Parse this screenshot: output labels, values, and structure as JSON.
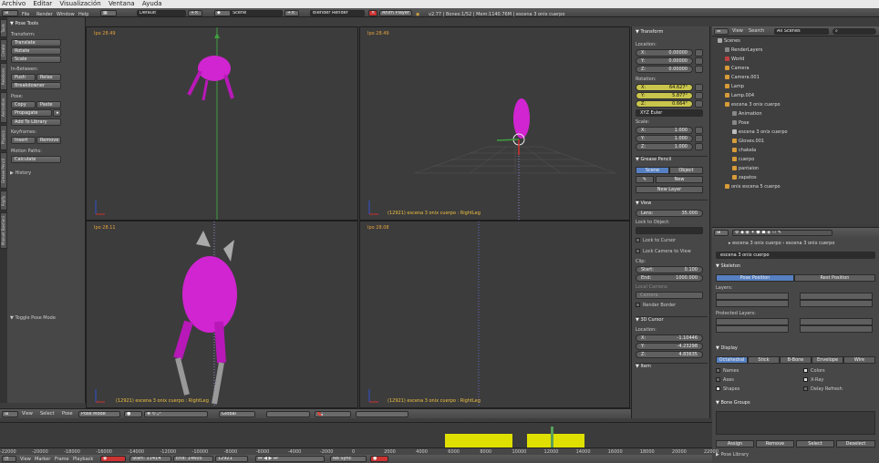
{
  "os_menu": [
    "Archivo",
    "Editar",
    "Visualización",
    "Ventana",
    "Ayuda"
  ],
  "info_header": {
    "menus": [
      "File",
      "Render",
      "Window",
      "Help"
    ],
    "screen_layout": "Default",
    "scene": "Scene",
    "render_engine": "Blender Render",
    "anim_player": "Anim Player",
    "stats": "v2.77 | Bones:1/52 | Mem:1140.76M | escena 3 onix cuerpo"
  },
  "left_tabs": [
    "Tools",
    "Create",
    "Relations",
    "Animation",
    "Physics",
    "Grease Pencil",
    "Rigify",
    "Manuel Bastioni"
  ],
  "tool_shelf": {
    "title": "Pose Tools",
    "transform_label": "Transform:",
    "transform_buttons": [
      "Translate",
      "Rotate",
      "Scale"
    ],
    "in_between_label": "In-Between:",
    "push": "Push",
    "relax": "Relax",
    "breakdowner": "Breakdowner",
    "pose_label": "Pose:",
    "copy": "Copy",
    "paste": "Paste",
    "propagate": "Propagate",
    "add_to_library": "Add To Library",
    "keyframes_label": "Keyframes:",
    "insert": "Insert",
    "remove": "Remove",
    "motion_paths_label": "Motion Paths:",
    "calculate": "Calculate",
    "history": "History",
    "toggle_pose_mode": "Toggle Pose Mode"
  },
  "viewports": [
    {
      "label": "Ipo 28.49",
      "status": ""
    },
    {
      "label": "Ipo 28.49",
      "status": "(12921) escena 3 onix cuerpo : RightLeg"
    },
    {
      "label": "Ipo 28.11",
      "status": "(12921) escena 3 onix cuerpo : RightLeg"
    },
    {
      "label": "Ipo 28.08",
      "status": "(12921) escena 3 onix cuerpo : RightLeg"
    }
  ],
  "viewport_statuses": [
    "(12921) escena 3 onix cuerpo : RightLeg",
    "(12921) escena 3 onix cuerpo : RightLeg"
  ],
  "viewport_header": {
    "view": "View",
    "select": "Select",
    "pose": "Pose",
    "mode": "Pose Mode",
    "orientation": "Global"
  },
  "transform_panel": {
    "title": "Transform",
    "location_label": "Location:",
    "location": [
      {
        "axis": "X:",
        "value": "0.00000"
      },
      {
        "axis": "Y:",
        "value": "0.00000"
      },
      {
        "axis": "Z:",
        "value": "0.00000"
      }
    ],
    "rotation_label": "Rotation:",
    "rotation": [
      {
        "axis": "X:",
        "value": "64.627°"
      },
      {
        "axis": "Y:",
        "value": "5.877°"
      },
      {
        "axis": "Z:",
        "value": "0.664°"
      }
    ],
    "rotation_mode": "XYZ Euler",
    "scale_label": "Scale:",
    "scale": [
      {
        "axis": "X:",
        "value": "1.000"
      },
      {
        "axis": "Y:",
        "value": "1.000"
      },
      {
        "axis": "Z:",
        "value": "1.000"
      }
    ]
  },
  "grease_pencil": {
    "title": "Grease Pencil",
    "scene": "Scene",
    "object": "Object",
    "new": "New",
    "new_layer": "New Layer"
  },
  "view_panel": {
    "title": "View",
    "lens_label": "Lens:",
    "lens": "35.000",
    "lock_to_object": "Lock to Object:",
    "lock_to_cursor": "Lock to Cursor",
    "lock_camera": "Lock Camera to View",
    "clip_label": "Clip:",
    "start_label": "Start:",
    "start": "0.100",
    "end_label": "End:",
    "end": "1000.000",
    "local_camera": "Local Camera:",
    "camera": "Camera",
    "render_border": "Render Border"
  },
  "cursor_panel": {
    "title": "3D Cursor",
    "location_label": "Location:",
    "location": [
      {
        "axis": "X:",
        "value": "-1.10446"
      },
      {
        "axis": "Y:",
        "value": "-4.23298"
      },
      {
        "axis": "Z:",
        "value": "4.83635"
      }
    ]
  },
  "item_label": "Item",
  "outliner": {
    "view": "View",
    "search": "Search",
    "filter": "All Scenes",
    "items": [
      {
        "label": "Scenes",
        "depth": 0,
        "color": "#aaaaaa"
      },
      {
        "label": "RenderLayers",
        "depth": 1,
        "color": "#888888"
      },
      {
        "label": "World",
        "depth": 1,
        "color": "#c04040"
      },
      {
        "label": "Camera",
        "depth": 1,
        "color": "#d79b38"
      },
      {
        "label": "Camera.001",
        "depth": 1,
        "color": "#d79b38"
      },
      {
        "label": "Lamp",
        "depth": 1,
        "color": "#d79b38"
      },
      {
        "label": "Lamp.004",
        "depth": 1,
        "color": "#d79b38"
      },
      {
        "label": "escena 3 onix cuerpo",
        "depth": 1,
        "color": "#d79b38"
      },
      {
        "label": "Animation",
        "depth": 2,
        "color": "#888888"
      },
      {
        "label": "Pose",
        "depth": 2,
        "color": "#888888"
      },
      {
        "label": "escena 3 onix cuerpo",
        "depth": 2,
        "color": "#bbbbbb"
      },
      {
        "label": "Gloves.001",
        "depth": 2,
        "color": "#d79b38"
      },
      {
        "label": "chakela",
        "depth": 2,
        "color": "#d79b38"
      },
      {
        "label": "cuerpo",
        "depth": 2,
        "color": "#d79b38"
      },
      {
        "label": "pantalon",
        "depth": 2,
        "color": "#d79b38"
      },
      {
        "label": "zapatos",
        "depth": 2,
        "color": "#d79b38"
      },
      {
        "label": "onix escena 5 cuerpo",
        "depth": 1,
        "color": "#d79b38"
      }
    ]
  },
  "bone_props": {
    "breadcrumb_1": "escena 3 onix cuerpo",
    "breadcrumb_2": "escena 3 onix cuerpo",
    "armature_name": "escena 3 onix cuerpo",
    "skeleton_title": "Skeleton",
    "pose_position": "Pose Position",
    "rest_position": "Rest Position",
    "layers_label": "Layers:",
    "protected_layers": "Protected Layers:",
    "display_title": "Display",
    "display_tabs": [
      "Octahedral",
      "Stick",
      "B-Bone",
      "Envelope",
      "Wire"
    ],
    "names": "Names",
    "axes": "Axes",
    "shapes": "Shapes",
    "colors": "Colors",
    "xray": "X-Ray",
    "delay_refresh": "Delay Refresh",
    "bone_groups": "Bone Groups",
    "assign": "Assign",
    "remove": "Remove",
    "select": "Select",
    "deselect": "Deselect",
    "pose_library": "Pose Library"
  },
  "timeline": {
    "ticks": [
      "-22000",
      "-20000",
      "-18000",
      "-16000",
      "-14000",
      "-12000",
      "-10000",
      "-8000",
      "-6000",
      "-4000",
      "-2000",
      "0",
      "2000",
      "4000",
      "6000",
      "8000",
      "10000",
      "12000",
      "14000",
      "16000",
      "18000",
      "20000",
      "22000"
    ],
    "menus": [
      "View",
      "Marker",
      "Frame",
      "Playback"
    ],
    "start_label": "Start:",
    "start": "11414",
    "end_label": "End:",
    "end": "14605",
    "current": "12921",
    "keying": "No Sync"
  },
  "colors": {
    "accent": "#5680c2",
    "timeline_range": "#e0e000",
    "status_text": "#f0c040"
  }
}
